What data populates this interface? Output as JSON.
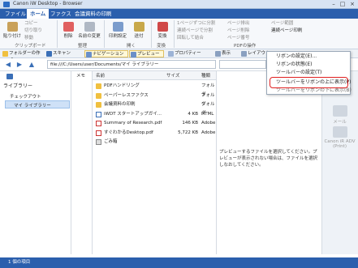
{
  "window": {
    "title": "Canon iW Desktop - Browser"
  },
  "tabs": [
    "ファイル",
    "ホーム",
    "ファクス",
    "会議資料の印刷"
  ],
  "ribbon": {
    "clipboard": {
      "paste": "貼り付け",
      "copy": "コピー",
      "cut": "切り取り",
      "shortcut": "移動",
      "label": "クリップボード"
    },
    "organize": {
      "delete": "削除",
      "rename": "名前の変更",
      "label": "整理"
    },
    "open": {
      "scan": "印刷設定",
      "app": "送付",
      "label": "開く"
    },
    "convert": {
      "label": "変換"
    },
    "pdf": {
      "a": "1ページずつに分割",
      "b": "連続ページで分割",
      "c": "回転して結合",
      "d": "ページ排出",
      "e": "ページ削除",
      "f": "ページ番号",
      "g": "ページ範囲",
      "h": "連続ページ印刷",
      "label": "PDFの操作"
    }
  },
  "toolbar": [
    "フォルダーの作成",
    "スキャン",
    "ナビゲーション",
    "プレビュー",
    "プロパティー",
    "表示",
    "レイアウト"
  ],
  "address": {
    "path": "file:///C:/Users/user/Documents/マイ ライブラリー"
  },
  "sidebar": {
    "title": "ライブラリー",
    "items": [
      "チェックアウト",
      "マイ ライブラリー"
    ]
  },
  "memo_header": "メモ",
  "columns": {
    "name": "名前",
    "size": "サイズ",
    "type": "種類"
  },
  "files": [
    {
      "name": "PDFハンドリング",
      "size": "",
      "type": "フォルダ",
      "icon": "folder"
    },
    {
      "name": "ペーパーレスファクス",
      "size": "",
      "type": "フォルダ",
      "icon": "folder"
    },
    {
      "name": "会議資料の印刷",
      "size": "",
      "type": "フォルダ",
      "icon": "folder"
    },
    {
      "name": "iWDT スタートアップガイ...",
      "size": "4 KB",
      "type": "HTML",
      "icon": "html"
    },
    {
      "name": "Summary of Research.pdf",
      "size": "146 KB",
      "type": "Adobe",
      "icon": "pdf"
    },
    {
      "name": "すぐわかるDesktop.pdf",
      "size": "5,722 KB",
      "type": "Adobe",
      "icon": "pdf"
    },
    {
      "name": "ごみ箱",
      "size": "",
      "type": "",
      "icon": "trash"
    }
  ],
  "preview": {
    "message": "プレビューするファイルを選択してください。プレビューが表示されない場合は、ファイルを選択しなおしてください。"
  },
  "right_pane": {
    "mail": "メール",
    "print": "Canon iR ADV (Print)"
  },
  "context_menu": {
    "items": [
      "リボンの設定(E)...",
      "リボンの状態(E)",
      "ツールバーの設定(T)",
      "ツールバーをリボンの上に表示(P)",
      "ツールバーをリボンの下に表示(B)"
    ],
    "highlighted_index": 3
  },
  "status": {
    "text": "1 個の項目"
  },
  "colors": {
    "accent": "#2b5fad",
    "highlight": "#e02020"
  }
}
